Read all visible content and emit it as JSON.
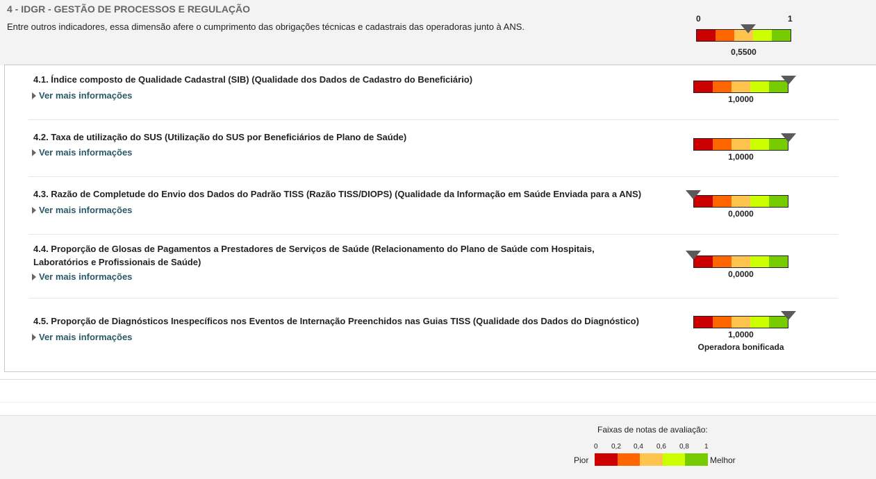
{
  "dimension": {
    "title": "4 - IDGR - GESTÃO DE PROCESSOS E REGULAÇÃO",
    "description": "Entre outros indicadores, essa dimensão afere o cumprimento das obrigações técnicas e cadastrais das operadoras junto à ANS.",
    "gauge": {
      "min_label": "0",
      "max_label": "1",
      "value": 0.55,
      "value_label": "0,5500"
    }
  },
  "colors": {
    "band1": "#cc0000",
    "band2": "#ff6600",
    "band3": "#ffc44d",
    "band4": "#ccff00",
    "band5": "#77cc00",
    "marker": "#5a5a5a",
    "link": "#2a5a68"
  },
  "indicators": [
    {
      "title": "4.1. Índice composto de Qualidade Cadastral (SIB) (Qualidade dos Dados de Cadastro do Beneficiário)",
      "link": "Ver mais informações",
      "value": 1.0,
      "value_label": "1,0000",
      "note": ""
    },
    {
      "title": "4.2. Taxa de utilização do SUS (Utilização do SUS por Beneficiários de Plano de Saúde)",
      "link": "Ver mais informações",
      "value": 1.0,
      "value_label": "1,0000",
      "note": ""
    },
    {
      "title": "4.3. Razão de Completude do Envio dos Dados do Padrão TISS (Razão TISS/DIOPS) (Qualidade da Informação em Saúde Enviada para a ANS)",
      "link": "Ver mais informações",
      "value": 0.0,
      "value_label": "0,0000",
      "note": ""
    },
    {
      "title": "4.4. Proporção de Glosas de Pagamentos a Prestadores de Serviços de Saúde (Relacionamento do Plano de Saúde com Hospitais, Laboratórios e Profissionais de Saúde)",
      "link": "Ver mais informações",
      "value": 0.0,
      "value_label": "0,0000",
      "note": ""
    },
    {
      "title": "4.5. Proporção de Diagnósticos Inespecíficos nos Eventos de Internação Preenchidos nas Guias TISS (Qualidade dos Dados do Diagnóstico)",
      "link": "Ver mais informações",
      "value": 1.0,
      "value_label": "1,0000",
      "note": "Operadora bonificada"
    }
  ],
  "legend": {
    "title": "Faixas de notas de avaliação:",
    "ticks": [
      "0",
      "0,2",
      "0,4",
      "0,6",
      "0,8",
      "1"
    ],
    "worst_label": "Pior",
    "best_label": "Melhor"
  }
}
